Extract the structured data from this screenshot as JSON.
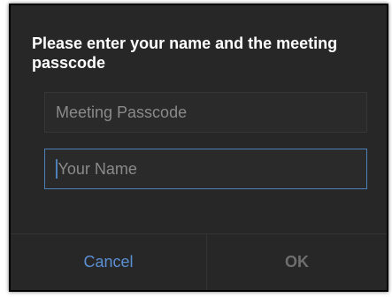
{
  "dialog": {
    "title": "Please enter your name and the meeting passcode",
    "passcode_field": {
      "placeholder": "Meeting Passcode",
      "value": ""
    },
    "name_field": {
      "placeholder": "Your Name",
      "value": ""
    },
    "buttons": {
      "cancel_label": "Cancel",
      "ok_label": "OK"
    }
  },
  "colors": {
    "dialog_background": "#272727",
    "accent_blue": "#5b8fd4",
    "focused_border": "#4d7fb8",
    "disabled_text": "#6e6e6e",
    "placeholder_text": "#8a8a8a"
  }
}
